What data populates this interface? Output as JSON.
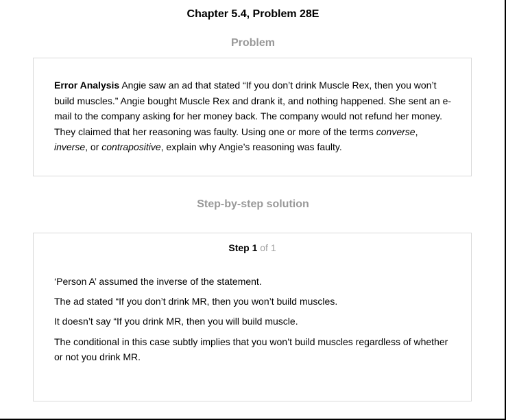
{
  "title": "Chapter 5.4, Problem 28E",
  "problem_section": {
    "heading": "Problem",
    "lead": "Error Analysis",
    "text_1": " Angie saw an ad that stated “If you don’t drink Muscle Rex, then you won’t build muscles.” Angie bought Muscle Rex and drank it, and nothing happened. She sent an e-mail to the company asking for her money back. The company would not refund her money. They claimed that her reasoning was faulty. Using one or more of the terms ",
    "term_1": "converse",
    "sep_1": ", ",
    "term_2": "inverse",
    "sep_2": ", or ",
    "term_3": "contrapositive",
    "text_2": ", explain why Angie’s reasoning was faulty."
  },
  "solution_section": {
    "heading": "Step-by-step solution",
    "step_label": "Step 1",
    "step_of": " of 1",
    "lines": [
      "‘Person A’ assumed the inverse of the statement.",
      "The ad stated “If you don’t drink MR, then you won’t build muscles.",
      "It doesn’t say “If you drink MR, then you will build muscle.",
      "The conditional in this case subtly implies that you won’t build muscles regardless of whether or not you drink MR."
    ]
  },
  "colors": {
    "section_heading": "#999999",
    "box_border": "#d9d9d9",
    "step_of": "#a0a0a0"
  }
}
